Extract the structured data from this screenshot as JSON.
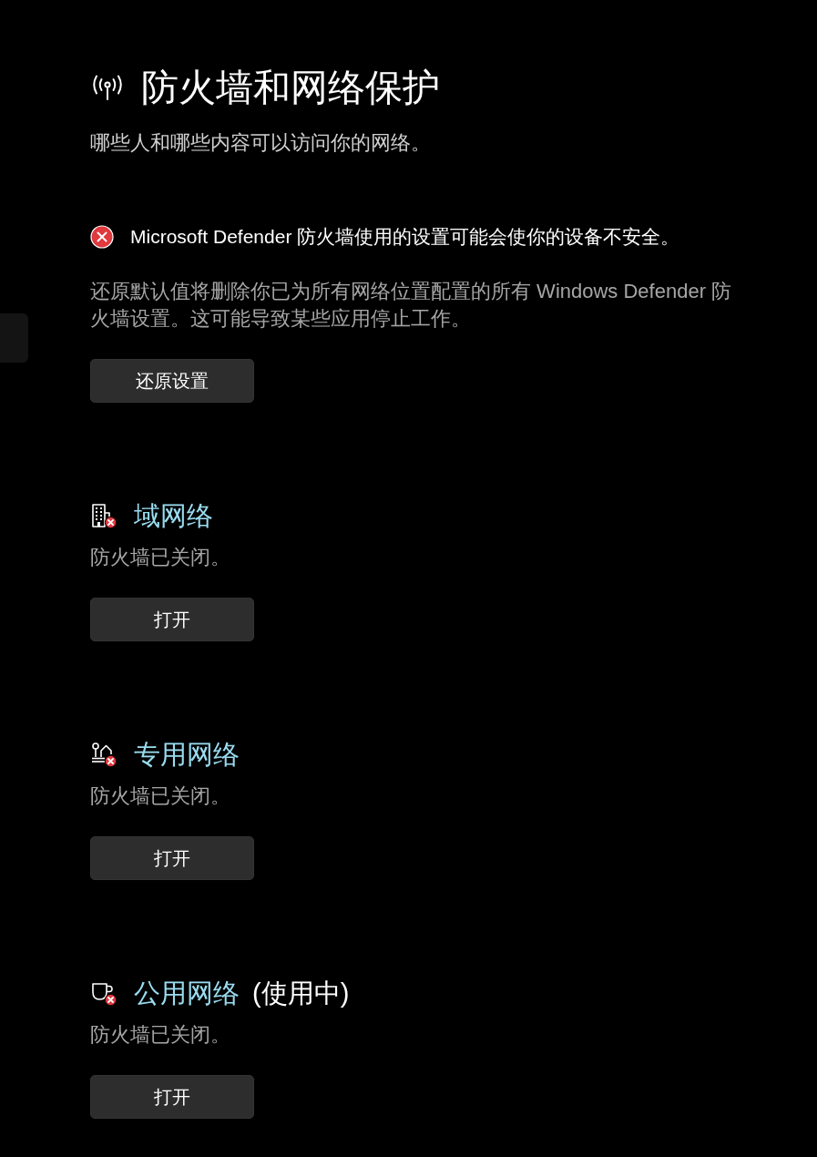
{
  "header": {
    "title": "防火墙和网络保护",
    "subtitle": "哪些人和哪些内容可以访问你的网络。"
  },
  "alert": {
    "kind": "error",
    "message": "Microsoft Defender 防火墙使用的设置可能会使你的设备不安全。",
    "description": "还原默认值将删除你已为所有网络位置配置的所有 Windows Defender 防火墙设置。这可能导致某些应用停止工作。",
    "button": "还原设置"
  },
  "networks": [
    {
      "kind": "domain",
      "name": "域网络",
      "enabled": false,
      "status": "防火墙已关闭。",
      "button": "打开"
    },
    {
      "kind": "private",
      "name": "专用网络",
      "enabled": false,
      "status": "防火墙已关闭。",
      "button": "打开"
    },
    {
      "kind": "public",
      "name": "公用网络",
      "in_use_label": "(使用中)",
      "enabled": false,
      "status": "防火墙已关闭。",
      "button": "打开"
    }
  ]
}
